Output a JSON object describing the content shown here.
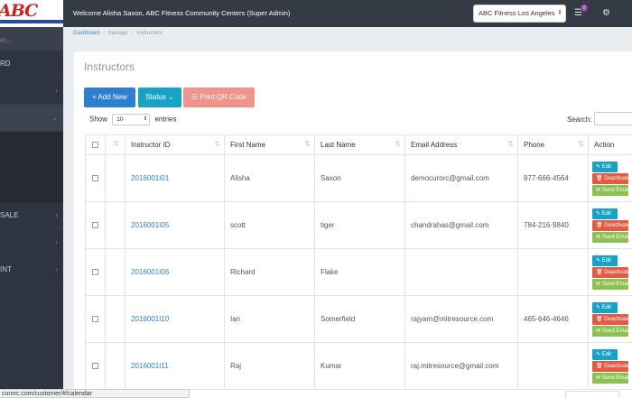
{
  "sidebar": {
    "logo_text": "ABC",
    "search_placeholder": "er...",
    "items": [
      {
        "label": "RD",
        "chevron": ""
      },
      {
        "label": "",
        "chevron": "›"
      },
      {
        "label": "",
        "chevron": "⌄"
      },
      {
        "label": "SALE",
        "chevron": "›"
      },
      {
        "label": "",
        "chevron": "›"
      },
      {
        "label": "INT",
        "chevron": "›"
      }
    ]
  },
  "topbar": {
    "welcome_prefix": "Welcome ",
    "user_name": "Alisha Saxon, ABC Fitness Community Centers",
    "role": " (Super Admin)",
    "location": "ABC Fitness Los Angeles",
    "notification_count": "0"
  },
  "breadcrumb": [
    "Dashboard",
    "Manage",
    "Instructors"
  ],
  "page": {
    "title": "Instructors",
    "add_label": "+ Add New",
    "status_label": "Status ⌄",
    "qr_label": "☰ Print QR Code",
    "show_label": "Show",
    "entries_value": "10",
    "entries_label": "entries",
    "search_label": "Search:"
  },
  "table": {
    "headers": [
      "",
      "Instructor ID",
      "First Name",
      "Last Name",
      "Email Address",
      "Phone",
      "Action"
    ],
    "rows": [
      {
        "id": "2016001I01",
        "first": "Alisha",
        "last": "Saxon",
        "email": "democurorc@gmail.com",
        "phone": "877-666-4564"
      },
      {
        "id": "2016001I05",
        "first": "scott",
        "last": "tiger",
        "email": "chandrahas@gmail.com",
        "phone": "784-216-9840"
      },
      {
        "id": "2016001I06",
        "first": "Richard",
        "last": "Flake",
        "email": "",
        "phone": ""
      },
      {
        "id": "2016001I10",
        "first": "Ian",
        "last": "Somerfield",
        "email": "rajyam@mitresource.com",
        "phone": "465-646-4646"
      },
      {
        "id": "2016001I11",
        "first": "Raj",
        "last": "Kumar",
        "email": "raj.mitresource@gmail.com",
        "phone": ""
      }
    ],
    "action_edit": "✎ Edit",
    "action_deactivate": "🗑 Deactivate",
    "action_send": "✉ Send Email"
  },
  "statusbar": {
    "url": "curorc.com/customer/#/calendar"
  }
}
